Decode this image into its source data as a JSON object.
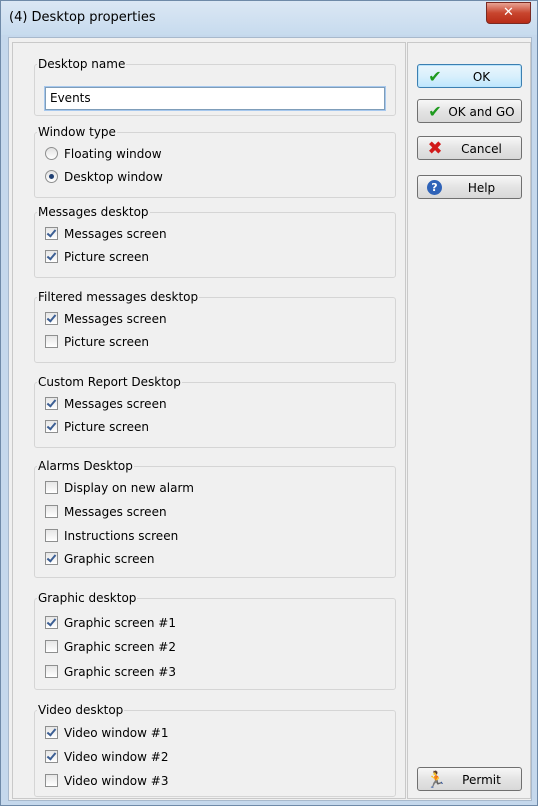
{
  "window": {
    "title": "(4)  Desktop properties",
    "close_glyph": "✕"
  },
  "desktop_name": {
    "label": "Desktop name",
    "value": "Events"
  },
  "window_type": {
    "label": "Window type",
    "options": [
      {
        "label": "Floating window",
        "checked": false
      },
      {
        "label": "Desktop window",
        "checked": true
      }
    ]
  },
  "groups": [
    {
      "label": "Messages desktop",
      "items": [
        {
          "label": "Messages screen",
          "checked": true
        },
        {
          "label": "Picture screen",
          "checked": true
        }
      ]
    },
    {
      "label": "Filtered messages desktop",
      "items": [
        {
          "label": "Messages screen",
          "checked": true
        },
        {
          "label": "Picture screen",
          "checked": false
        }
      ]
    },
    {
      "label": "Custom Report Desktop",
      "items": [
        {
          "label": "Messages screen",
          "checked": true
        },
        {
          "label": "Picture screen",
          "checked": true
        }
      ]
    },
    {
      "label": "Alarms Desktop",
      "items": [
        {
          "label": "Display on new alarm",
          "checked": false
        },
        {
          "label": "Messages screen",
          "checked": false
        },
        {
          "label": "Instructions screen",
          "checked": false
        },
        {
          "label": "Graphic screen",
          "checked": true
        }
      ]
    },
    {
      "label": "Graphic desktop",
      "items": [
        {
          "label": "Graphic screen #1",
          "checked": true
        },
        {
          "label": "Graphic screen #2",
          "checked": false
        },
        {
          "label": "Graphic screen #3",
          "checked": false
        }
      ]
    },
    {
      "label": "Video desktop",
      "items": [
        {
          "label": "Video window #1",
          "checked": true
        },
        {
          "label": "Video window #2",
          "checked": true
        },
        {
          "label": "Video window #3",
          "checked": false
        }
      ]
    }
  ],
  "buttons": {
    "ok": {
      "label": "OK",
      "icon": "checkmark-icon"
    },
    "ok_and_go": {
      "label": "OK and GO",
      "icon": "checkmark-icon"
    },
    "cancel": {
      "label": "Cancel",
      "icon": "red-x-icon"
    },
    "help": {
      "label": "Help",
      "icon": "question-icon"
    },
    "permit": {
      "label": "Permit",
      "icon": "running-man-icon"
    }
  },
  "colors": {
    "accent_check": "#1e9a1e",
    "cancel_red": "#d11a1a",
    "help_blue": "#2f63b8",
    "title_bar": "#c7dbee"
  }
}
